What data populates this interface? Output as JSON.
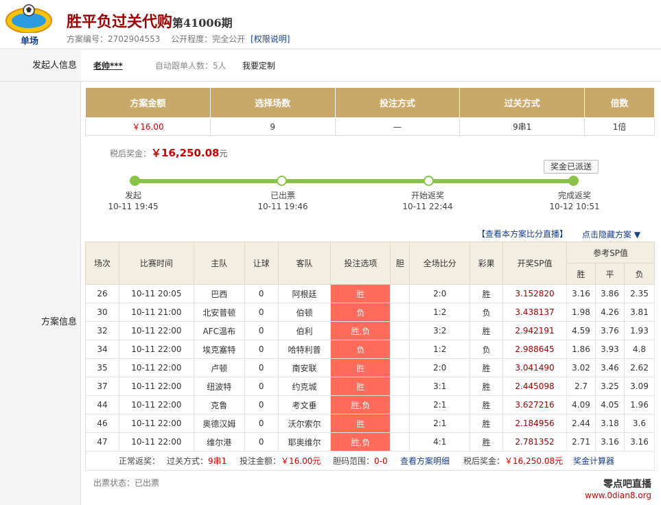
{
  "header": {
    "logo_text": "单场",
    "title": "胜平负过关代购",
    "period": "第41006期",
    "scheme_no_label": "方案编号：",
    "scheme_no": "2702904553",
    "public_label": "公开程度：",
    "public_value": "完全公开",
    "permission_link": "[权限说明]"
  },
  "initiator": {
    "label": "发起人信息",
    "name": "老帅***",
    "follow_text": "自动跟单人数：5人",
    "custom_link": "我要定制"
  },
  "scheme_label": "方案信息",
  "summary": {
    "headers": [
      "方案金额",
      "选择场数",
      "投注方式",
      "过关方式",
      "倍数"
    ],
    "values": [
      "￥16.00",
      "9",
      "—",
      "9串1",
      "1倍"
    ]
  },
  "prize": {
    "label": "税后奖金：",
    "amount": "￥16,250.08",
    "unit": "元"
  },
  "progress": {
    "badge": "奖金已派送",
    "steps": [
      {
        "label": "发起",
        "time": "10-11 19:45"
      },
      {
        "label": "已出票",
        "time": "10-11 19:46"
      },
      {
        "label": "开始返奖",
        "time": "10-11 22:44"
      },
      {
        "label": "完成返奖",
        "time": "10-12 10:51"
      }
    ]
  },
  "links": {
    "live": "【查看本方案比分直播】",
    "hide": "点击隐藏方案 ▼"
  },
  "matches": {
    "headers": [
      "场次",
      "比赛时间",
      "主队",
      "让球",
      "客队",
      "投注选项",
      "胆",
      "全场比分",
      "彩果",
      "开奖SP值",
      "参考SP值"
    ],
    "sp_sub": [
      "胜",
      "平",
      "负"
    ],
    "rows": [
      [
        "26",
        "10-11 20:05",
        "巴西",
        "0",
        "阿根廷",
        "胜",
        "",
        "2:0",
        "胜",
        "3.152820",
        "3.16",
        "3.86",
        "2.35"
      ],
      [
        "30",
        "10-11 21:00",
        "北安普顿",
        "0",
        "伯顿",
        "负",
        "",
        "1:2",
        "负",
        "3.438137",
        "1.98",
        "4.26",
        "3.81"
      ],
      [
        "32",
        "10-11 22:00",
        "AFC温布",
        "0",
        "伯利",
        "胜,负",
        "",
        "3:2",
        "胜",
        "2.942191",
        "4.59",
        "3.76",
        "1.93"
      ],
      [
        "34",
        "10-11 22:00",
        "埃克塞特",
        "0",
        "哈特利普",
        "负",
        "",
        "1:2",
        "负",
        "2.988645",
        "1.86",
        "3.93",
        "4.8"
      ],
      [
        "35",
        "10-11 22:00",
        "卢顿",
        "0",
        "南安联",
        "胜",
        "",
        "2:0",
        "胜",
        "3.041490",
        "3.02",
        "3.46",
        "2.62"
      ],
      [
        "37",
        "10-11 22:00",
        "纽波特",
        "0",
        "约克城",
        "胜",
        "",
        "3:1",
        "胜",
        "2.445098",
        "2.7",
        "3.25",
        "3.09"
      ],
      [
        "44",
        "10-11 22:00",
        "克鲁",
        "0",
        "考文垂",
        "胜,负",
        "",
        "2:1",
        "胜",
        "3.627216",
        "4.09",
        "4.05",
        "1.96"
      ],
      [
        "46",
        "10-11 22:00",
        "奥德汉姆",
        "0",
        "沃尔索尔",
        "胜",
        "",
        "2:1",
        "胜",
        "2.184956",
        "2.44",
        "3.18",
        "3.6"
      ],
      [
        "47",
        "10-11 22:00",
        "维尔港",
        "0",
        "耶奥维尔",
        "胜,负",
        "",
        "4:1",
        "胜",
        "2.781352",
        "2.71",
        "3.16",
        "3.16"
      ]
    ]
  },
  "footer": {
    "normal": "正常返奖：",
    "pass_label": "过关方式：",
    "pass_value": "9串1",
    "bet_label": "投注金额：",
    "bet_value": "￥16.00元",
    "range_label": "胆码范围：",
    "range_value": "0-0",
    "detail_link": "查看方案明细",
    "after_tax_label": "税后奖金：",
    "after_tax_value": "￥16,250.08元",
    "calc_link": "奖金计算器"
  },
  "ticket_status": "出票状态：已出票",
  "watermark": {
    "line1": "零点吧直播",
    "line2": "www.0dian8.org"
  },
  "colors": {
    "gold_header": "#c8a96a",
    "bet_cell": "#ff6b5b",
    "progress": "#8bc34a",
    "title": "#a00000"
  }
}
